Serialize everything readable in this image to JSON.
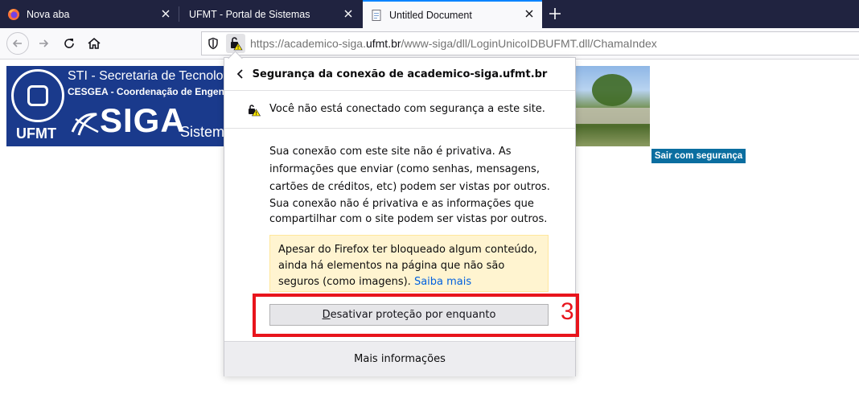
{
  "tabs": [
    {
      "title": "Nova aba",
      "icon": "firefox-icon"
    },
    {
      "title": "UFMT - Portal de Sistemas",
      "icon": ""
    },
    {
      "title": "Untitled Document",
      "icon": "document-icon",
      "active": true
    }
  ],
  "navbar": {
    "url_prefix": "https://academico-siga.",
    "url_host": "ufmt.br",
    "url_path": "/www-siga/dll/LoginUnicoIDBUFMT.dll/ChamaIndex"
  },
  "banner": {
    "line1": "STI - Secretaria de Tecnologia d",
    "line2": "CESGEA - Coordenação de Engenharia",
    "siga": "SIGA",
    "sistema": "Sistema",
    "ufmt": "UFMT"
  },
  "logout_label": "Sair com segurança",
  "panel": {
    "title": "Segurança da conexão de academico-siga.ufmt.br",
    "status": "Você não está conectado com segurança a este site.",
    "para1": "Sua conexão com este site não é privativa. As informações que enviar (como senhas, mensagens, cartões de créditos, etc) podem ser vistas por outros.",
    "para2": "Sua conexão não é privativa e as informações que compartilhar com o site podem ser vistas por outros.",
    "warning": "Apesar do Firefox ter bloqueado algum conteúdo, ainda há elementos na página que não são seguros (como imagens).",
    "learn_more": "Saiba mais",
    "disable_btn_first": "D",
    "disable_btn_rest": "esativar proteção por enquanto",
    "more_info": "Mais informações"
  },
  "annotation": {
    "number": "3",
    "color": "#e8141c"
  },
  "colors": {
    "tabstrip": "#202340",
    "accent": "#0a84ff",
    "logout": "#0b6ea0",
    "warning_bg": "#fff4d0"
  }
}
